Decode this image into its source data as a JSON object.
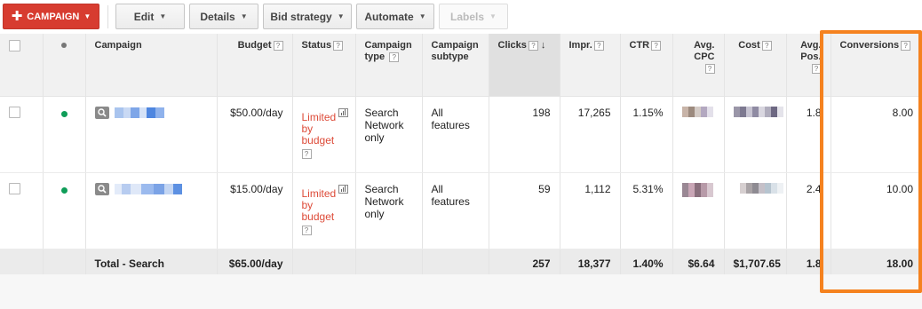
{
  "toolbar": {
    "campaign_label": "CAMPAIGN",
    "edit_label": "Edit",
    "details_label": "Details",
    "bid_strategy_label": "Bid strategy",
    "automate_label": "Automate",
    "labels_label": "Labels"
  },
  "headers": {
    "campaign": "Campaign",
    "budget": "Budget",
    "status": "Status",
    "campaign_type": "Campaign type",
    "campaign_subtype": "Campaign subtype",
    "clicks": "Clicks",
    "impr": "Impr.",
    "ctr": "CTR",
    "avg_cpc": "Avg. CPC",
    "cost": "Cost",
    "avg_pos": "Avg. Pos.",
    "conversions": "Conversions",
    "help": "?"
  },
  "rows": [
    {
      "budget": "$50.00/day",
      "status": "Limited by budget",
      "campaign_type": "Search Network only",
      "campaign_subtype": "All features",
      "clicks": "198",
      "impr": "17,265",
      "ctr": "1.15%",
      "avg_pos": "1.8",
      "conversions": "8.00"
    },
    {
      "budget": "$15.00/day",
      "status": "Limited by budget",
      "campaign_type": "Search Network only",
      "campaign_subtype": "All features",
      "clicks": "59",
      "impr": "1,112",
      "ctr": "5.31%",
      "avg_pos": "2.4",
      "conversions": "10.00"
    }
  ],
  "total": {
    "label": "Total - Search",
    "budget": "$65.00/day",
    "clicks": "257",
    "impr": "18,377",
    "ctr": "1.40%",
    "avg_cpc": "$6.64",
    "cost": "$1,707.65",
    "avg_pos": "1.8",
    "conversions": "18.00"
  },
  "colors": {
    "primary_button": "#d73c30",
    "status_limited": "#dd4b39",
    "enabled_dot": "#0f9d58",
    "highlight": "#f5821f"
  },
  "icons": [
    "plus-icon",
    "chevron-down-icon",
    "sort-down-arrow-icon",
    "search-icon",
    "chart-icon",
    "pencil-icon",
    "help-icon"
  ]
}
